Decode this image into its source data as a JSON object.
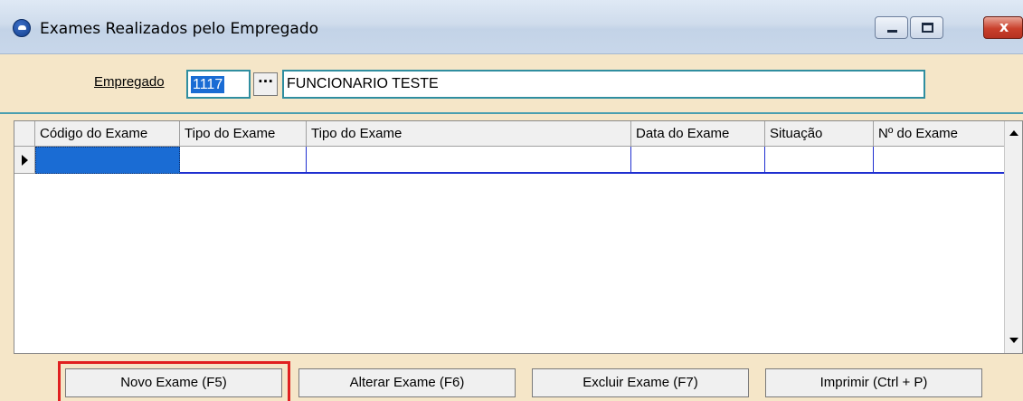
{
  "window": {
    "title": "Exames Realizados pelo Empregado",
    "close_glyph": "x"
  },
  "form": {
    "empregado_label": "Empregado",
    "empregado_code": "1117",
    "lookup_glyph": "···",
    "empregado_name": "FUNCIONARIO TESTE"
  },
  "grid": {
    "columns": [
      "Código do Exame",
      "Tipo do Exame",
      "Tipo do Exame",
      "Data do Exame",
      "Situação",
      "Nº do Exame"
    ],
    "rows": [
      [
        "",
        "",
        "",
        "",
        "",
        ""
      ]
    ]
  },
  "buttons": {
    "novo": "Novo Exame (F5)",
    "alterar": "Alterar Exame (F6)",
    "excluir": "Excluir Exame (F7)",
    "imprimir": "Imprimir (Ctrl + P)"
  },
  "colors": {
    "background": "#f5e6c8",
    "selection": "#1a6cd4",
    "highlight": "#e02020"
  }
}
